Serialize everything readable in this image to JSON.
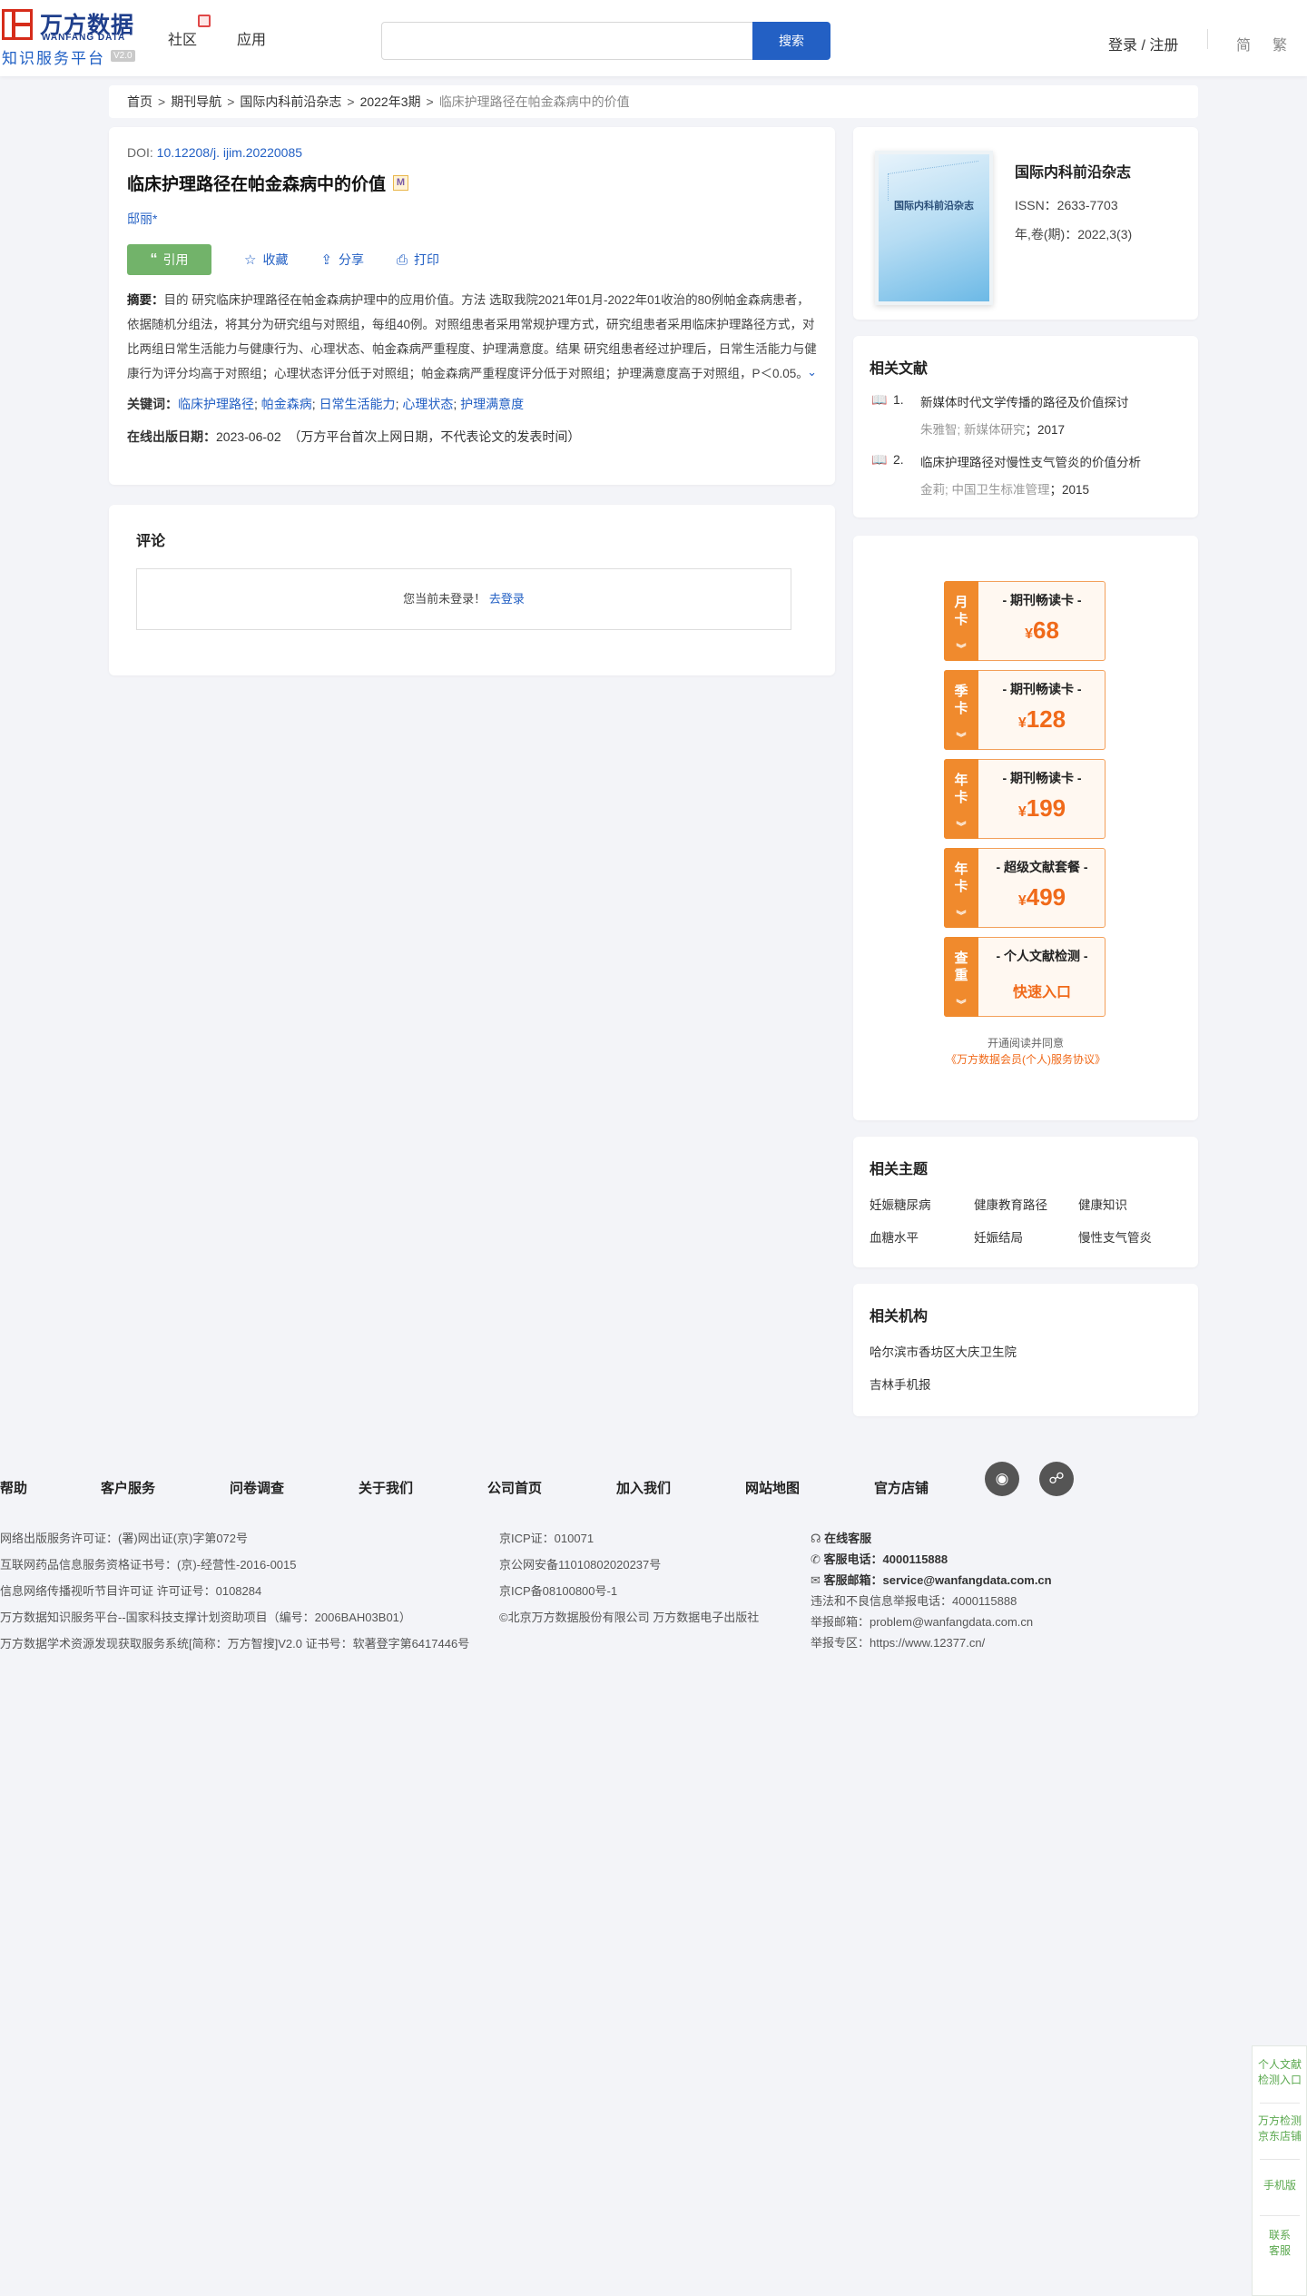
{
  "header": {
    "logo_cn": "万方数据",
    "logo_en": "WANFANG DATA",
    "logo_sub": "知识服务平台",
    "logo_ver": "V2.0",
    "nav": [
      "社区",
      "应用"
    ],
    "search_placeholder": "",
    "search_button": "搜索",
    "login": "登录 / 注册",
    "lang_simplified": "简",
    "lang_traditional": "繁"
  },
  "breadcrumb": {
    "items": [
      "首页",
      "期刊导航",
      "国际内科前沿杂志",
      "2022年3期"
    ],
    "current": "临床护理路径在帕金森病中的价值",
    "separator": ">"
  },
  "article": {
    "doi_label": "DOI: ",
    "doi": "10.12208/j. ijim.20220085",
    "title": "临床护理路径在帕金森病中的价值",
    "m_badge": "M",
    "author": "邸丽*",
    "actions": {
      "cite": "引用",
      "favorite": "收藏",
      "share": "分享",
      "print": "打印"
    },
    "abstract_label": "摘要：",
    "abstract": "目的 研究临床护理路径在帕金森病护理中的应用价值。方法 选取我院2021年01月-2022年01收治的80例帕金森病患者，依据随机分组法，将其分为研究组与对照组，每组40例。对照组患者采用常规护理方式，研究组患者采用临床护理路径方式，对比两组日常生活能力与健康行为、心理状态、帕金森病严重程度、护理满意度。结果 研究组患者经过护理后，日常生活能力与健康行为评分均高于对照组；心理状态评分低于对照组；帕金森病严重程度评分低于对照组；护理满意度高于对照组，P＜0.05。结论 临床护理路径在帕金森病患者中应用，可提高患者的生活体力与健康行为，减轻疾病严重程度...",
    "keywords_label": "关键词：",
    "keywords": [
      "临床护理路径",
      "帕金森病",
      "日常生活能力",
      "心理状态",
      "护理满意度"
    ],
    "pubdate_label": "在线出版日期：",
    "pubdate": "2023-06-02",
    "pubdate_note": "（万方平台首次上网日期，不代表论文的发表时间）"
  },
  "comment": {
    "title": "评论",
    "not_logged": "您当前未登录！",
    "login_link": "去登录"
  },
  "journal": {
    "cover_title": "国际内科前沿杂志",
    "name": "国际内科前沿杂志",
    "issn": "ISSN：2633-7703",
    "volume": "年,卷(期)：2022,3(3)"
  },
  "related": {
    "title": "相关文献",
    "items": [
      {
        "num": "1.",
        "title": "新媒体时代文学传播的路径及价值探讨",
        "authors": "朱雅智; ",
        "source": "新媒体研究",
        "year": "；2017"
      },
      {
        "num": "2.",
        "title": "临床护理路径对慢性支气管炎的价值分析",
        "authors": "金莉; ",
        "source": "中国卫生标准管理",
        "year": "；2015"
      }
    ]
  },
  "promo": {
    "cards": [
      {
        "tag": [
          "月",
          "卡"
        ],
        "name": "- 期刊畅读卡 -",
        "price": "68",
        "currency": "¥"
      },
      {
        "tag": [
          "季",
          "卡"
        ],
        "name": "- 期刊畅读卡 -",
        "price": "128",
        "currency": "¥"
      },
      {
        "tag": [
          "年",
          "卡"
        ],
        "name": "- 期刊畅读卡 -",
        "price": "199",
        "currency": "¥"
      },
      {
        "tag": [
          "年",
          "卡"
        ],
        "name": "- 超级文献套餐 -",
        "price": "499",
        "currency": "¥"
      },
      {
        "tag": [
          "查",
          "重"
        ],
        "name": "- 个人文献检测 -",
        "entry": "快速入口"
      }
    ],
    "note": "开通阅读并同意",
    "agreement": "《万方数据会员(个人)服务协议》",
    "accent_color": "#f08a2d"
  },
  "topics": {
    "title": "相关主题",
    "items": [
      "妊娠糖尿病",
      "健康教育路径",
      "健康知识",
      "血糖水平",
      "妊娠结局",
      "慢性支气管炎"
    ]
  },
  "orgs": {
    "title": "相关机构",
    "items": [
      "哈尔滨市香坊区大庆卫生院",
      "吉林手机报"
    ]
  },
  "footer": {
    "nav": [
      "帮助",
      "客户服务",
      "问卷调查",
      "关于我们",
      "公司首页",
      "加入我们",
      "网站地图",
      "官方店铺"
    ],
    "sns": [
      "weibo-icon",
      "wechat-icon"
    ],
    "col1": [
      "网络出版服务许可证：(署)网出证(京)字第072号",
      "互联网药品信息服务资格证书号：(京)-经营性-2016-0015",
      "信息网络传播视听节目许可证 许可证号：0108284",
      "万方数据知识服务平台--国家科技支撑计划资助项目（编号：2006BAH03B01）",
      "万方数据学术资源发现获取服务系统[简称：万方智搜]V2.0 证书号：软著登字第6417446号"
    ],
    "col2": [
      "京ICP证：010071",
      "京公网安备11010802020237号",
      "京ICP备08100800号-1",
      "©北京万方数据股份有限公司 万方数据电子出版社"
    ],
    "col3": {
      "online": "在线客服",
      "phone_label": "客服电话：",
      "phone": "4000115888",
      "mail_label": "客服邮箱：",
      "mail": "service@wanfangdata.com.cn",
      "report_phone": "违法和不良信息举报电话：4000115888",
      "report_mail": "举报邮箱：problem@wanfangdata.com.cn",
      "report_area": "举报专区：https://www.12377.cn/"
    }
  },
  "side": {
    "items": [
      [
        "个人文献",
        "检测入口"
      ],
      [
        "万方检测",
        "京东店铺"
      ],
      [
        "手机版"
      ],
      [
        "联系",
        "客服"
      ]
    ],
    "color": "#5aa84e"
  },
  "colors": {
    "brand_blue": "#2360c4",
    "logo_red": "#d62c1a",
    "cite_green": "#72b36a",
    "price_orange": "#f06a1a"
  }
}
